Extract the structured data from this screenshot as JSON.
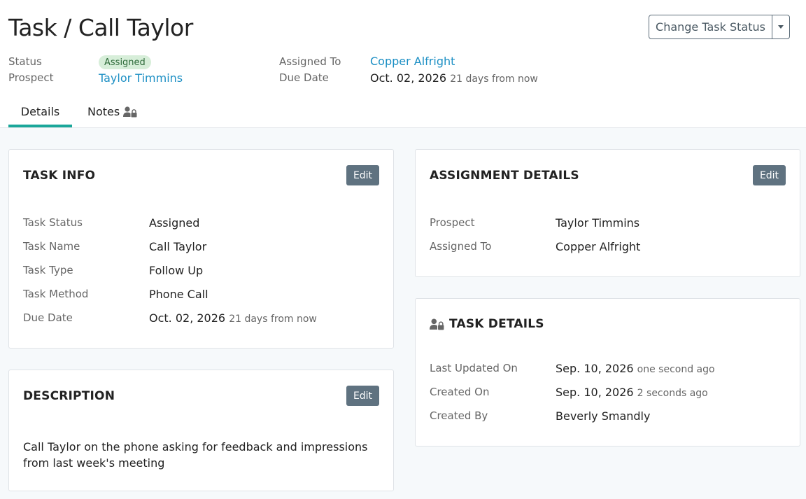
{
  "header": {
    "title": "Task / Call Taylor",
    "change_status_label": "Change Task Status",
    "status_label": "Status",
    "status_badge": "Assigned",
    "prospect_label": "Prospect",
    "prospect_value": "Taylor Timmins",
    "assigned_to_label": "Assigned To",
    "assigned_to_value": "Copper Alfright",
    "due_date_label": "Due Date",
    "due_date_value": "Oct. 02, 2026",
    "due_date_relative": "21 days from now"
  },
  "tabs": [
    {
      "label": "Details",
      "active": true
    },
    {
      "label": "Notes",
      "icon": "user-lock-icon"
    }
  ],
  "task_info": {
    "title": "TASK INFO",
    "edit_label": "Edit",
    "rows": [
      {
        "label": "Task Status",
        "value": "Assigned"
      },
      {
        "label": "Task Name",
        "value": "Call Taylor"
      },
      {
        "label": "Task Type",
        "value": "Follow Up"
      },
      {
        "label": "Task Method",
        "value": "Phone Call"
      },
      {
        "label": "Due Date",
        "value": "Oct. 02, 2026",
        "relative": "21 days from now"
      }
    ]
  },
  "description": {
    "title": "DESCRIPTION",
    "edit_label": "Edit",
    "text": "Call Taylor on the phone asking for feedback and impressions from last week's meeting"
  },
  "assignment": {
    "title": "ASSIGNMENT DETAILS",
    "edit_label": "Edit",
    "rows": [
      {
        "label": "Prospect",
        "value": "Taylor Timmins"
      },
      {
        "label": "Assigned To",
        "value": "Copper Alfright"
      }
    ]
  },
  "task_details": {
    "title": "TASK DETAILS",
    "icon": "user-lock-icon",
    "rows": [
      {
        "label": "Last Updated On",
        "value": "Sep. 10, 2026",
        "relative": "one second ago"
      },
      {
        "label": "Created On",
        "value": "Sep. 10, 2026",
        "relative": "2 seconds ago"
      },
      {
        "label": "Created By",
        "value": "Beverly Smandly"
      }
    ]
  },
  "colors": {
    "link": "#1c8fc4",
    "tab_accent": "#1aa79a",
    "edit_button": "#5f7280",
    "badge_bg": "#d7eed9",
    "page_bg": "#f6f9fb"
  }
}
